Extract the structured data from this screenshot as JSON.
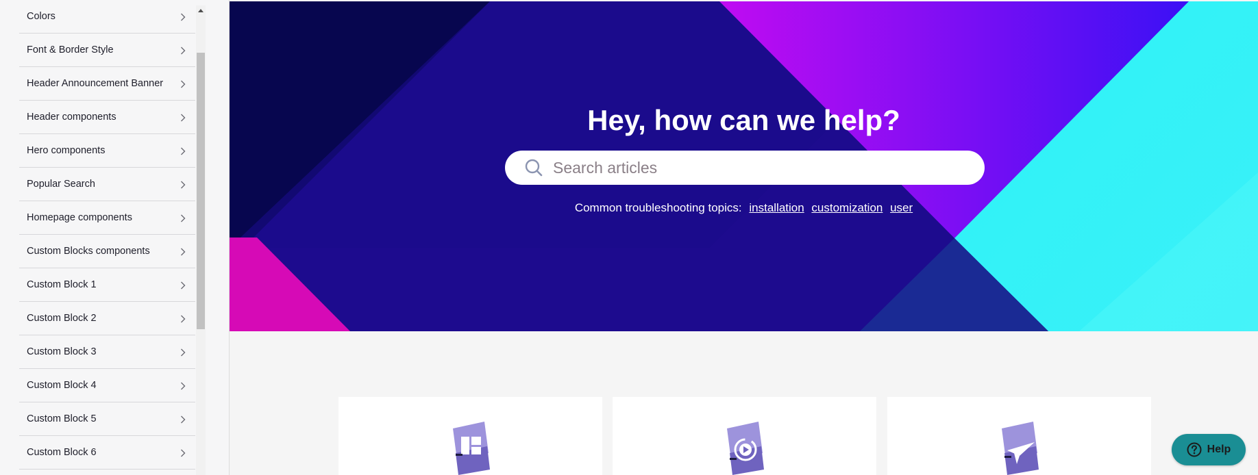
{
  "sidebar": {
    "items": [
      {
        "label": "Colors"
      },
      {
        "label": "Font & Border Style"
      },
      {
        "label": "Header Announcement Banner"
      },
      {
        "label": "Header components"
      },
      {
        "label": "Hero components"
      },
      {
        "label": "Popular Search"
      },
      {
        "label": "Homepage components"
      },
      {
        "label": "Custom Blocks components"
      },
      {
        "label": "Custom Block 1"
      },
      {
        "label": "Custom Block 2"
      },
      {
        "label": "Custom Block 3"
      },
      {
        "label": "Custom Block 4"
      },
      {
        "label": "Custom Block 5"
      },
      {
        "label": "Custom Block 6"
      }
    ],
    "item_icon": "chevron-right-icon"
  },
  "hero": {
    "title": "Hey, how can we help?",
    "search": {
      "placeholder": "Search articles",
      "value": "",
      "icon": "search-icon"
    },
    "topics": {
      "prefix": "Common troubleshooting topics:",
      "links": [
        "installation",
        "customization",
        "user"
      ]
    },
    "colors": {
      "base": "#1a0c8c",
      "magenta": "#d400b8",
      "violet": "#a40cf5",
      "cyan": "#2ff2f4"
    }
  },
  "cards": [
    {
      "icon": "layout-block-icon"
    },
    {
      "icon": "video-play-icon"
    },
    {
      "icon": "send-plane-icon"
    }
  ],
  "help_button": {
    "label": "Help",
    "icon": "question-circle-icon",
    "color": "#1a8e94"
  }
}
